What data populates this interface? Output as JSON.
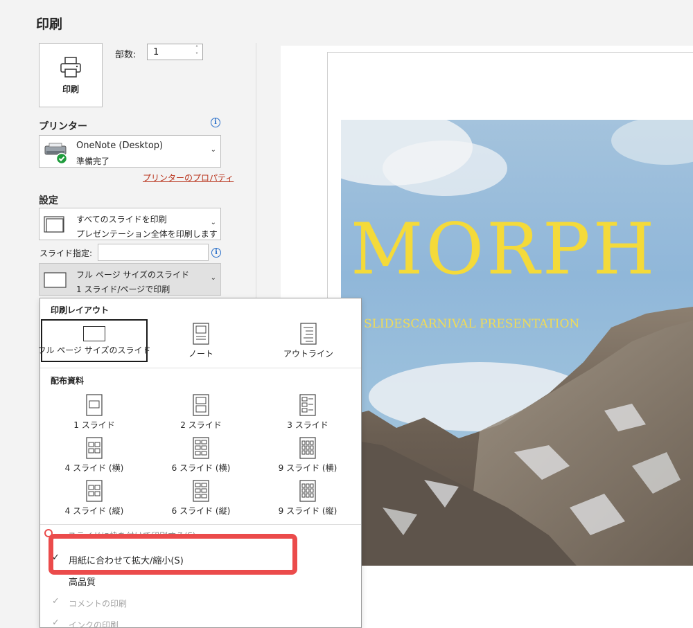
{
  "header": {
    "title": "印刷"
  },
  "print": {
    "button_label": "印刷",
    "copies_label": "部数:",
    "copies_value": "1"
  },
  "printer": {
    "heading": "プリンター",
    "name": "OneNote (Desktop)",
    "status": "準備完了",
    "properties_link": "プリンターのプロパティ"
  },
  "settings": {
    "heading": "設定",
    "range_title": "すべてのスライドを印刷",
    "range_desc": "プレゼンテーション全体を印刷します",
    "slides_label": "スライド指定:",
    "slides_value": "",
    "layout_title": "フル ページ サイズのスライド",
    "layout_desc": "1 スライド/ページで印刷"
  },
  "menu": {
    "layout_heading": "印刷レイアウト",
    "layouts": [
      "フル ページ サイズのスライド",
      "ノート",
      "アウトライン"
    ],
    "handouts_heading": "配布資料",
    "handouts": [
      [
        "1 スライド",
        "2 スライド",
        "3 スライド"
      ],
      [
        "4 スライド (横)",
        "6 スライド (横)",
        "9 スライド (横)"
      ],
      [
        "4 スライド (縦)",
        "6 スライド (縦)",
        "9 スライド (縦)"
      ]
    ],
    "options": {
      "frame": "スライドに枠を付けて印刷する(F)",
      "scale": "用紙に合わせて拡大/縮小(S)",
      "high_quality": "高品質",
      "comments": "コメントの印刷",
      "ink": "インクの印刷"
    }
  },
  "preview": {
    "title": "MORPH",
    "subtitle": "SLIDESCARNIVAL PRESENTATION"
  },
  "colors": {
    "accent_link": "#b9341d",
    "highlight": "#eb4b4b",
    "slide_title": "#f4da3a"
  }
}
